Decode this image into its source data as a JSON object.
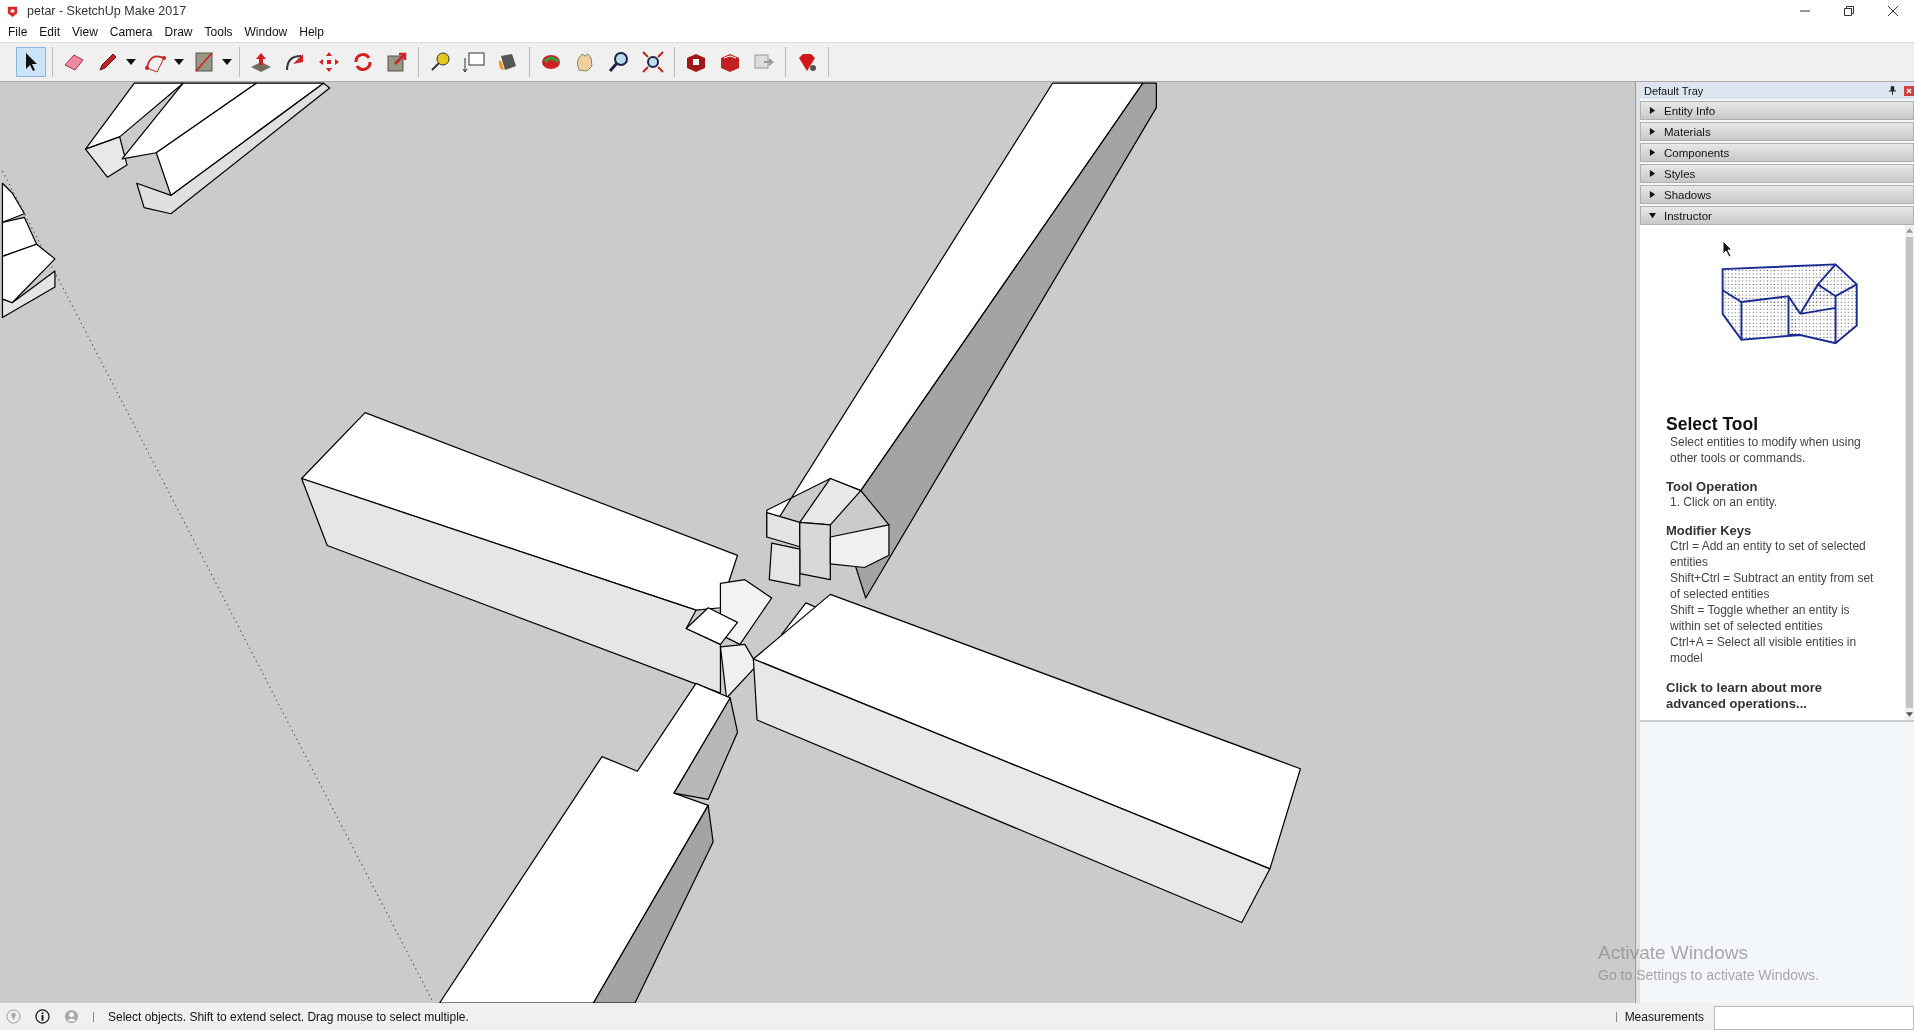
{
  "window": {
    "title": "petar - SketchUp Make 2017"
  },
  "menu": [
    "File",
    "Edit",
    "View",
    "Camera",
    "Draw",
    "Tools",
    "Window",
    "Help"
  ],
  "toolbar": [
    [
      {
        "kind": "select",
        "selected": true,
        "menu": false
      }
    ],
    [
      {
        "kind": "eraser",
        "selected": false,
        "menu": false
      },
      {
        "kind": "pencil",
        "selected": false,
        "menu": true
      },
      {
        "kind": "arc",
        "selected": false,
        "menu": true
      },
      {
        "kind": "rectangle",
        "selected": false,
        "menu": true
      }
    ],
    [
      {
        "kind": "pushpull",
        "selected": false,
        "menu": false
      },
      {
        "kind": "followme",
        "selected": false,
        "menu": false
      },
      {
        "kind": "move",
        "selected": false,
        "menu": false
      },
      {
        "kind": "rotate",
        "selected": false,
        "menu": false
      },
      {
        "kind": "scale",
        "selected": false,
        "menu": false
      }
    ],
    [
      {
        "kind": "tape",
        "selected": false,
        "menu": false
      },
      {
        "kind": "text",
        "selected": false,
        "menu": false
      },
      {
        "kind": "paint",
        "selected": false,
        "menu": false
      }
    ],
    [
      {
        "kind": "orbit",
        "selected": false,
        "menu": false
      },
      {
        "kind": "pan",
        "selected": false,
        "menu": false
      },
      {
        "kind": "zoom",
        "selected": false,
        "menu": false
      },
      {
        "kind": "extents",
        "selected": false,
        "menu": false
      }
    ],
    [
      {
        "kind": "warehouse",
        "selected": false,
        "menu": false
      },
      {
        "kind": "share",
        "selected": false,
        "menu": false
      },
      {
        "kind": "layout",
        "selected": false,
        "menu": false
      }
    ],
    [
      {
        "kind": "ruby",
        "selected": false,
        "menu": false
      }
    ]
  ],
  "tray": {
    "title": "Default Tray",
    "panels": [
      {
        "title": "Entity Info",
        "expanded": false
      },
      {
        "title": "Materials",
        "expanded": false
      },
      {
        "title": "Components",
        "expanded": false
      },
      {
        "title": "Styles",
        "expanded": false
      },
      {
        "title": "Shadows",
        "expanded": false
      },
      {
        "title": "Instructor",
        "expanded": true
      }
    ],
    "instructor": {
      "heading": "Select Tool",
      "intro": "Select entities to modify when using other tools or commands.",
      "sections": [
        {
          "title": "Tool Operation",
          "lines": [
            "1. Click on an entity."
          ]
        },
        {
          "title": "Modifier Keys",
          "lines": [
            "Ctrl = Add an entity to set of selected entities",
            "Shift+Ctrl = Subtract an entity from set of selected entities",
            "Shift = Toggle whether an entity is within set of selected entities",
            "Ctrl+A = Select all visible entities in model"
          ]
        }
      ],
      "link": "Click to learn about more advanced operations..."
    }
  },
  "activation": {
    "title": "Activate Windows",
    "message": "Go to Settings to activate Windows."
  },
  "status_bar": {
    "message": "Select objects. Shift to extend select. Drag mouse to select multiple.",
    "measurements_label": "Measurements"
  }
}
